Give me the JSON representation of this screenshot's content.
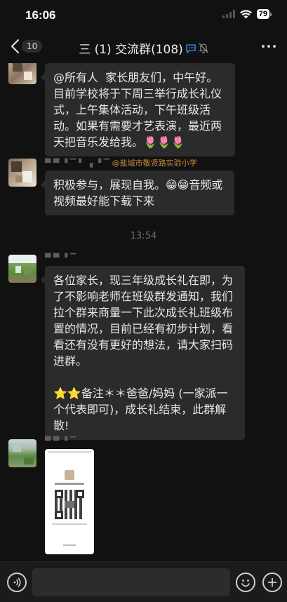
{
  "status_bar": {
    "time": "16:06",
    "battery": "79"
  },
  "header": {
    "back_count": "10",
    "title": "三 (1) 交流群(108)"
  },
  "messages": [
    {
      "text": "@所有人  家长朋友们，中午好。目前学校将于下周三举行成长礼仪式，上午集体活动，下午班级活动。如果有需要才艺表演，最近两天把音乐发给我。🌷🌷🌷"
    },
    {
      "sender_tag": "@盐城市敬贤路实验小学",
      "text": "积极参与，展现自我。😁😁音频或视频最好能下载下来"
    },
    {
      "text": "各位家长，现三年级成长礼在即，为了不影响老师在班级群发通知，我们拉个群来商量一下此次成长礼班级布置的情况，目前已经有初步计划，看看还有没有更好的想法，请大家扫码进群。\n\n⭐⭐备注＊＊爸爸/妈妈 (一家派一个代表即可)，成长礼结束，此群解散!"
    }
  ],
  "timestamp": "13:54",
  "icons": {
    "back": "chevron-left-icon",
    "chat_bubble": "chat-bubble-icon",
    "mute": "bell-muted-icon",
    "more": "more-dots-icon",
    "voice": "voice-icon",
    "emoji": "emoji-icon",
    "plus": "plus-icon"
  },
  "colors": {
    "background": "#111111",
    "bubble": "#2b2b2b",
    "accent_blue": "#3d7bd8",
    "tag_orange": "#c98a3a"
  }
}
